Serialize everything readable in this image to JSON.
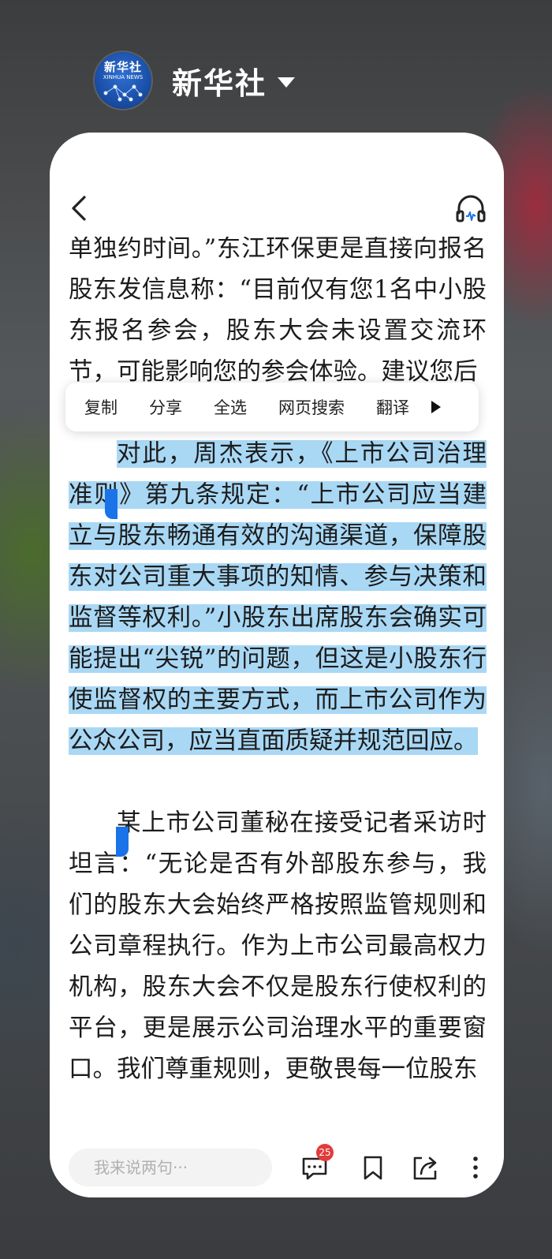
{
  "header": {
    "logo_cn": "新华社",
    "logo_en": "XINHUA NEWS",
    "app_name": "新华社"
  },
  "article": {
    "para_top": "单独约时间。”东江环保更是直接向报名股东发信息称：“目前仅有您1名中小股东报名参会，股东大会未设置交流环节，可能影响您的参会体验。建议您后",
    "para_selected": "对此，周杰表示，《上市公司治理准则》第九条规定：“上市公司应当建立与股东畅通有效的沟通渠道，保障股东对公司重大事项的知情、参与决策和监督等权利。”小股东出席股东会确实可能提出“尖锐”的问题，但这是小股东行使监督权的主要方式，而上市公司作为公众公司，应当直面质疑并规范回应。",
    "para_bottom": "某上市公司董秘在接受记者采访时坦言：“无论是否有外部股东参与，我们的股东大会始终严格按照监管规则和公司章程执行。作为上市公司最高权力机构，股东大会不仅是股东行使权利的平台，更是展示公司治理水平的重要窗口。我们尊重规则，更敬畏每一位股东"
  },
  "context_menu": {
    "copy": "复制",
    "share": "分享",
    "select_all": "全选",
    "web_search": "网页搜索",
    "translate": "翻译"
  },
  "bottom_bar": {
    "comment_placeholder": "我来说两句···",
    "comment_count": "25"
  },
  "colors": {
    "selection": "#a9d8f5",
    "handle": "#1a73e8",
    "badge": "#e23b3b",
    "logo": "#1a4fa8"
  },
  "icons": {
    "back": "chevron-left-icon",
    "listen": "headphones-icon",
    "comments": "chat-bubble-icon",
    "favorite": "bookmark-icon",
    "share": "share-icon",
    "more": "more-vertical-icon",
    "menu_more": "triangle-right-icon"
  }
}
